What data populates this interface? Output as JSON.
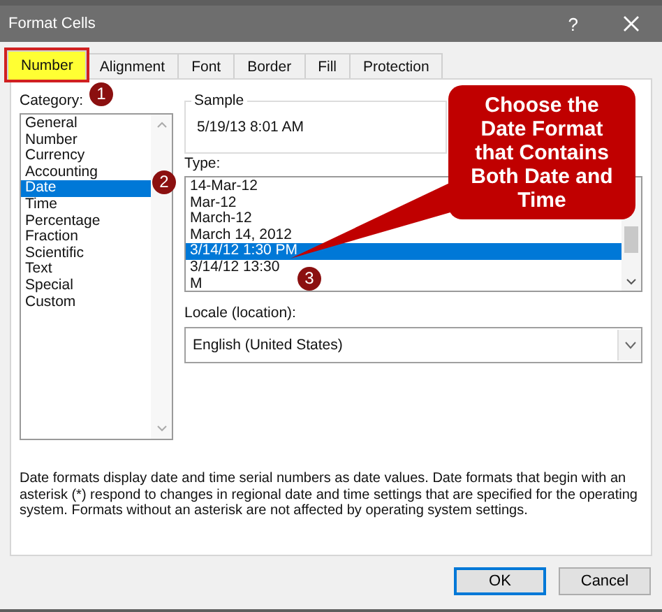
{
  "window": {
    "title": "Format Cells",
    "help": "?"
  },
  "tabs": [
    {
      "label": "Number",
      "selected": true,
      "highlighted": true
    },
    {
      "label": "Alignment",
      "selected": false,
      "highlighted": false
    },
    {
      "label": "Font",
      "selected": false,
      "highlighted": false
    },
    {
      "label": "Border",
      "selected": false,
      "highlighted": false
    },
    {
      "label": "Fill",
      "selected": false,
      "highlighted": false
    },
    {
      "label": "Protection",
      "selected": false,
      "highlighted": false
    }
  ],
  "category": {
    "label": "Category:",
    "items": [
      {
        "label": "General",
        "selected": false
      },
      {
        "label": "Number",
        "selected": false
      },
      {
        "label": "Currency",
        "selected": false
      },
      {
        "label": "Accounting",
        "selected": false
      },
      {
        "label": "Date",
        "selected": true
      },
      {
        "label": "Time",
        "selected": false
      },
      {
        "label": "Percentage",
        "selected": false
      },
      {
        "label": "Fraction",
        "selected": false
      },
      {
        "label": "Scientific",
        "selected": false
      },
      {
        "label": "Text",
        "selected": false
      },
      {
        "label": "Special",
        "selected": false
      },
      {
        "label": "Custom",
        "selected": false
      }
    ]
  },
  "sample": {
    "label": "Sample",
    "value": "5/19/13 8:01 AM"
  },
  "type": {
    "label": "Type:",
    "items": [
      {
        "label": "14-Mar-12",
        "selected": false
      },
      {
        "label": "Mar-12",
        "selected": false
      },
      {
        "label": "March-12",
        "selected": false
      },
      {
        "label": "March 14, 2012",
        "selected": false
      },
      {
        "label": "3/14/12 1:30 PM",
        "selected": true
      },
      {
        "label": "3/14/12 13:30",
        "selected": false
      },
      {
        "label": "M",
        "selected": false
      }
    ]
  },
  "locale": {
    "label": "Locale (location):",
    "value": "English (United States)"
  },
  "description": "Date formats display date and time serial numbers as date values.  Date formats that begin with an asterisk (*) respond to changes in regional date and time settings that are specified for the operating system. Formats without an asterisk are not affected by operating system settings.",
  "buttons": [
    {
      "label": "OK",
      "kind": "default"
    },
    {
      "label": "Cancel",
      "kind": "normal"
    }
  ],
  "annotations": {
    "markers": [
      {
        "text": "1"
      },
      {
        "text": "2"
      },
      {
        "text": "3"
      }
    ],
    "callout": "Choose the Date Format that Contains Both Date and Time"
  }
}
